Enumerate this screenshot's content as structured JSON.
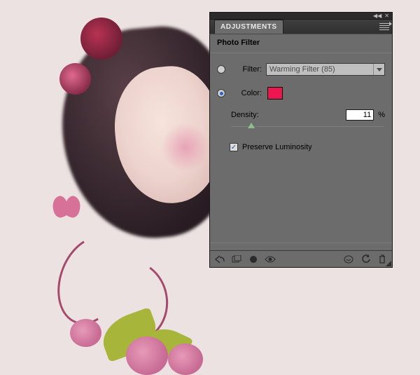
{
  "panel": {
    "tab_label": "ADJUSTMENTS",
    "title": "Photo Filter",
    "filter": {
      "label": "Filter:",
      "selected": "Warming Filter (85)",
      "checked": false
    },
    "color": {
      "label": "Color:",
      "checked": true,
      "hex": "#ED1651"
    },
    "density": {
      "label": "Density:",
      "value": "11",
      "unit": "%",
      "percent": 11
    },
    "preserve_luminosity": {
      "label": "Preserve Luminosity",
      "checked": true
    }
  },
  "collapse": {
    "left_glyph": "◀◀",
    "close_glyph": "✕"
  }
}
